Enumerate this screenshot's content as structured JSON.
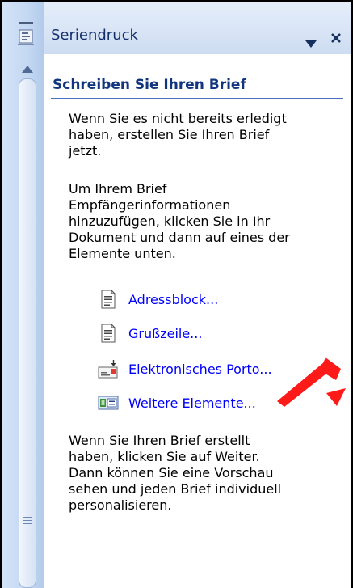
{
  "pane": {
    "title": "Seriendruck",
    "section_heading": "Schreiben Sie Ihren Brief",
    "paragraph_1": "Wenn Sie es nicht bereits erledigt\nhaben, erstellen Sie Ihren Brief\njetzt.",
    "paragraph_2": "Um Ihrem Brief\nEmpfängerinformationen\nhinzuzufügen, klicken Sie in Ihr\nDokument und dann auf eines der\nElemente unten.",
    "links": [
      {
        "label": "Adressblock...",
        "icon": "document-icon"
      },
      {
        "label": "Grußzeile...",
        "icon": "document-icon"
      },
      {
        "label": "Elektronisches Porto...",
        "icon": "envelope-stamp-icon"
      },
      {
        "label": "Weitere Elemente...",
        "icon": "fields-icon"
      }
    ],
    "paragraph_3": "Wenn Sie Ihren Brief erstellt\nhaben, klicken Sie auf Weiter.\nDann können Sie eine Vorschau\nsehen und jeden Brief individuell\npersonalisieren."
  },
  "colors": {
    "link": "#0000ff",
    "heading": "#12357f",
    "arrow": "#ff0000"
  }
}
